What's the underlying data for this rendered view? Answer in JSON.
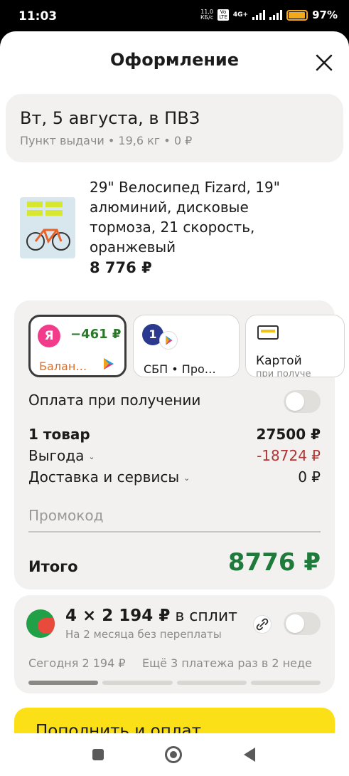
{
  "status_bar": {
    "time": "11:03",
    "net_speed_value": "11,0",
    "net_speed_unit": "КБ/с",
    "badge_top": "Vo",
    "badge_bottom": "LTE",
    "network": "4G+",
    "battery_level": 0.97,
    "battery": "97%"
  },
  "header": {
    "title": "Оформление",
    "close_icon": "close-icon"
  },
  "delivery": {
    "title": "Вт, 5 августа, в ПВЗ",
    "subtitle": "Пункт выдачи • 19,6 кг • 0 ₽"
  },
  "product": {
    "name": "29\" Велосипед Fizard, 19\" алюминий, дисковые тормоза, 21 скорость, оранжевый",
    "price": "8 776 ₽",
    "image_icon": "bicycle-image"
  },
  "payment_methods": [
    {
      "logo": "Я",
      "amount": "−461 ₽",
      "label": "Балан…",
      "icon": "bonus-icon"
    },
    {
      "logo": "1",
      "label": "СБП • Про…",
      "icon": "sbp-icon"
    },
    {
      "label": "Картой",
      "sub": "при получе",
      "icon": "card-icon"
    }
  ],
  "cash_on_delivery": {
    "label": "Оплата при получении",
    "enabled": false
  },
  "summary": {
    "items_label": "1 товар",
    "items_value": "27500 ₽",
    "discount_label": "Выгода",
    "discount_value": "-18724 ₽",
    "delivery_label": "Доставка и сервисы",
    "delivery_value": "0 ₽"
  },
  "promo": {
    "placeholder": "Промокод"
  },
  "total": {
    "label": "Итого",
    "value": "8776 ₽"
  },
  "split": {
    "title_prefix": "4 × 2 194 ₽",
    "title_suffix": " в сплит",
    "subtitle": "На 2 месяца без переплаты",
    "today": "Сегодня 2 194 ₽",
    "rest": "Ещё 3 платежа раз в 2 неде",
    "enabled": false,
    "payments_done": 1,
    "payments_total": 4
  },
  "cta": {
    "label": "Пополнить и оплат"
  },
  "colors": {
    "accent": "#fbe017",
    "total": "#1f7a3c",
    "discount": "#b03535"
  }
}
